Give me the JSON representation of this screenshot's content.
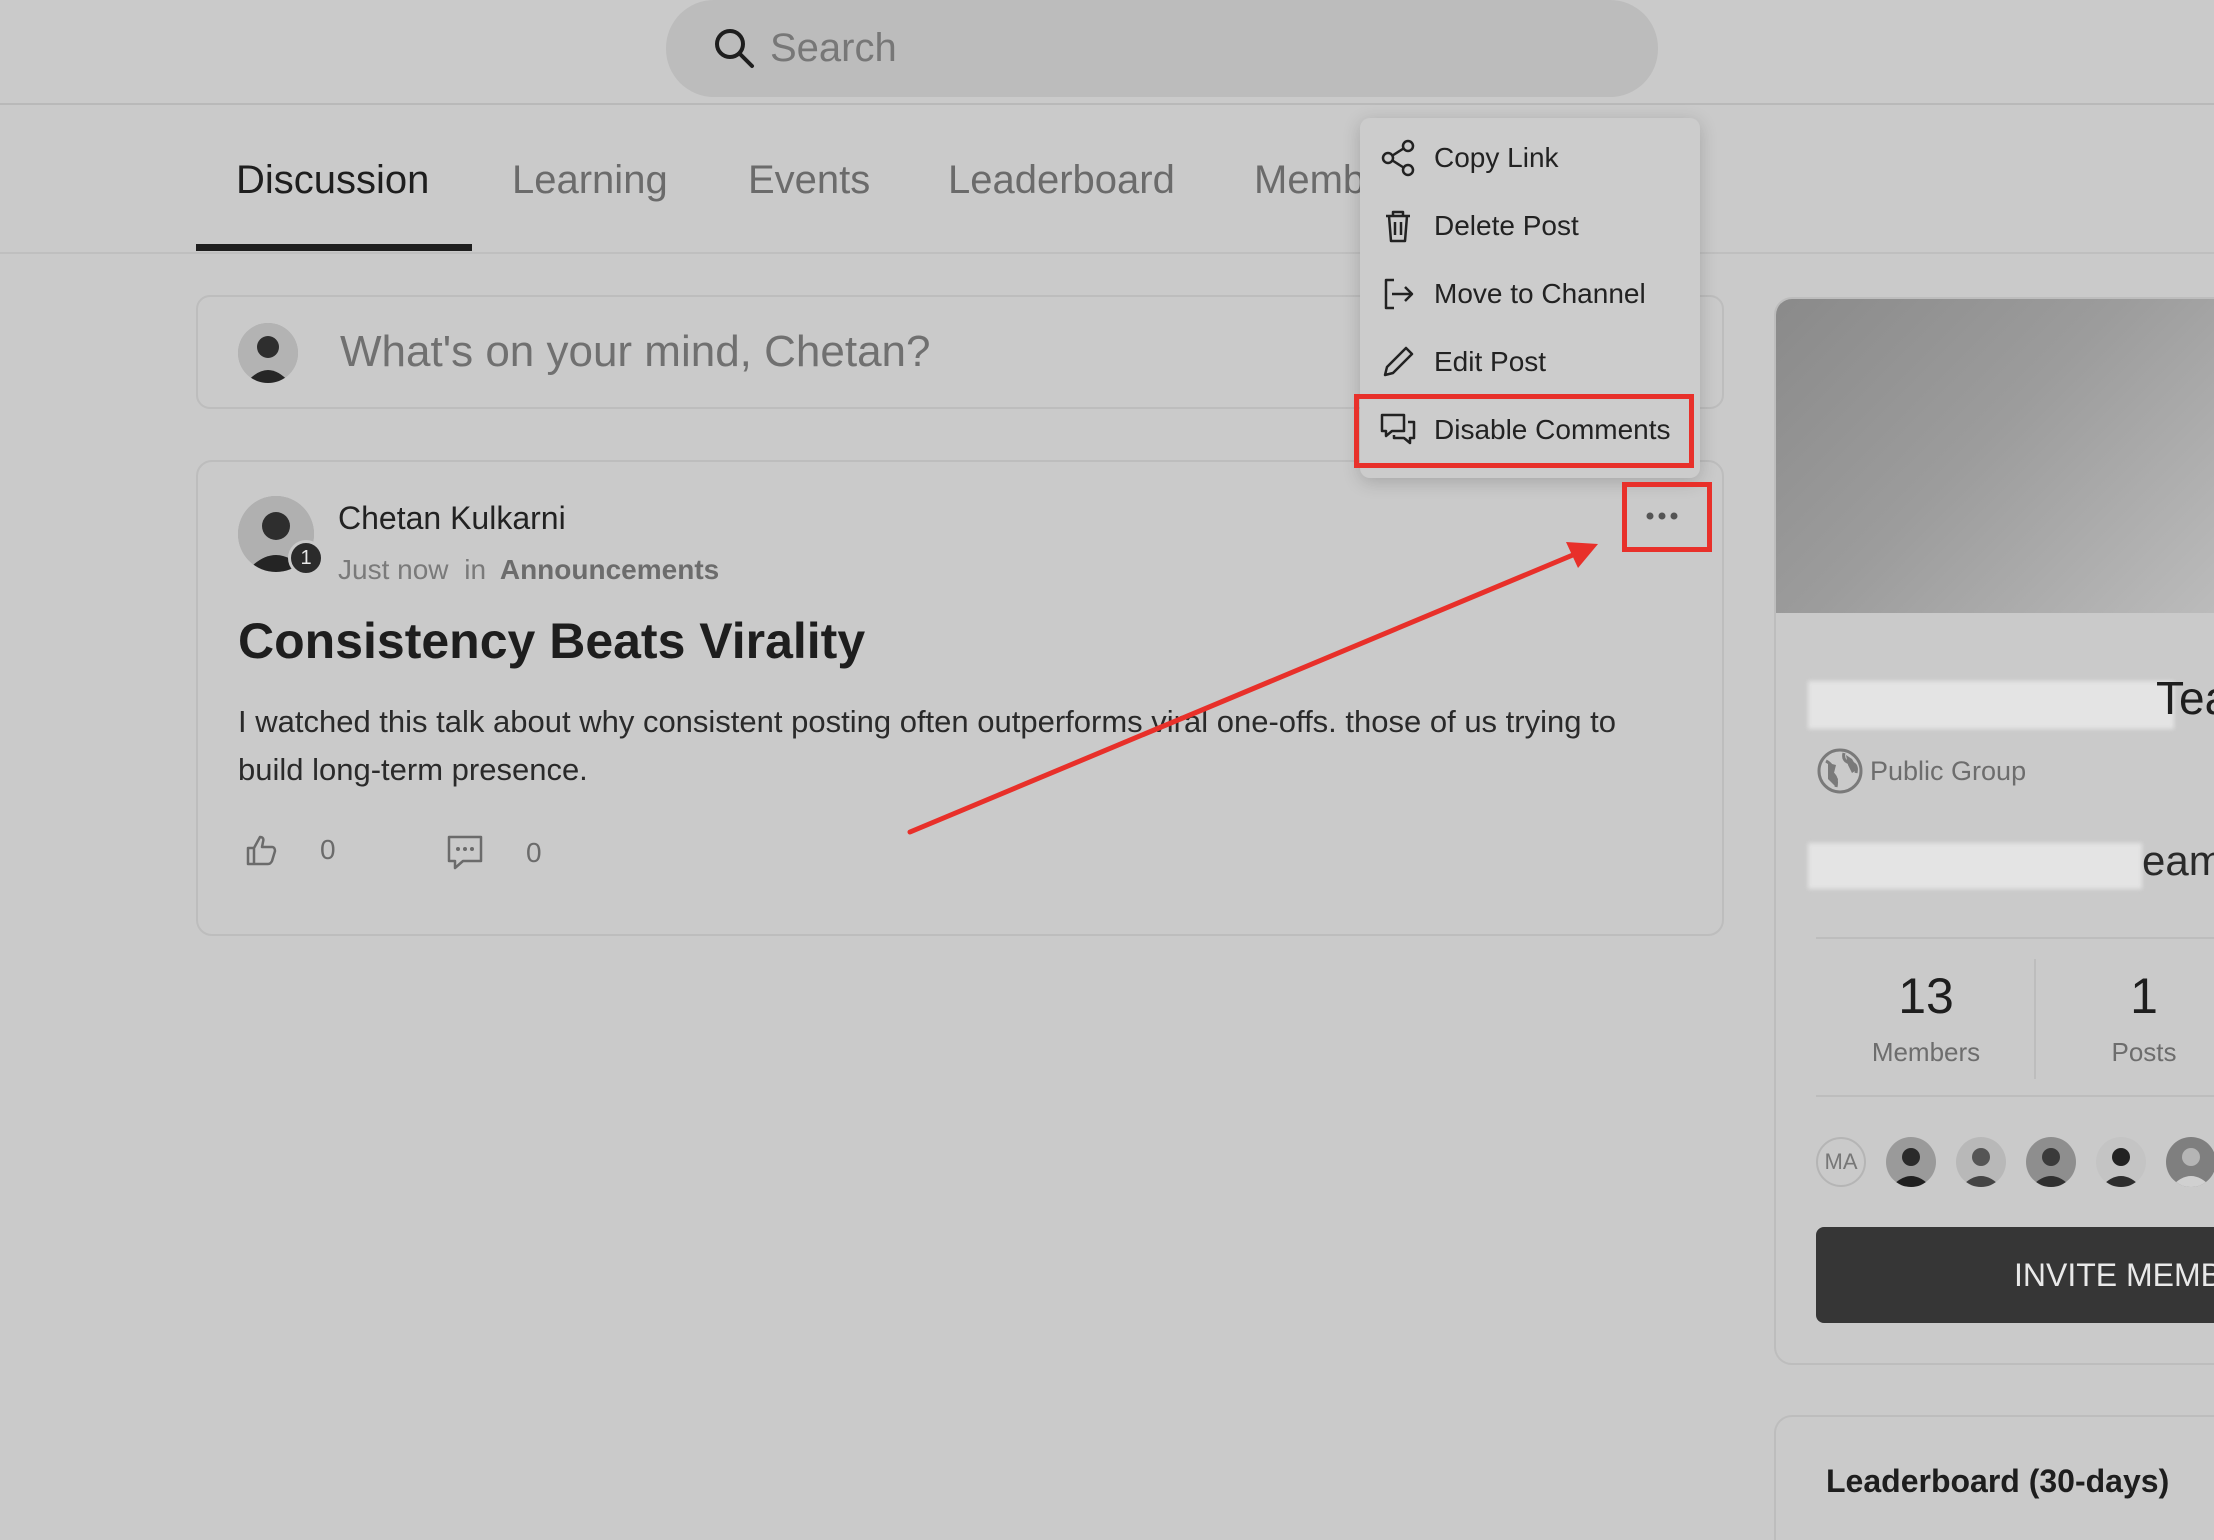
{
  "search": {
    "placeholder": "Search"
  },
  "tabs": [
    {
      "label": "Discussion"
    },
    {
      "label": "Learning"
    },
    {
      "label": "Events"
    },
    {
      "label": "Leaderboard"
    },
    {
      "label": "Memb"
    }
  ],
  "composer": {
    "prompt": "What's on your mind, Chetan?"
  },
  "post": {
    "author": "Chetan Kulkarni",
    "badge": "1",
    "time": "Just now",
    "in_word": "in",
    "channel": "Announcements",
    "title": "Consistency Beats Virality",
    "body": "I watched this talk about why consistent posting often outperforms viral one-offs. those of us trying to build long-term presence.",
    "likes": "0",
    "comments": "0"
  },
  "menu": {
    "items": [
      {
        "label": "Copy Link",
        "icon": "share-icon"
      },
      {
        "label": "Delete Post",
        "icon": "trash-icon"
      },
      {
        "label": "Move to Channel",
        "icon": "move-icon"
      },
      {
        "label": "Edit Post",
        "icon": "pencil-icon"
      },
      {
        "label": "Disable Comments",
        "icon": "comments-icon"
      }
    ]
  },
  "sidebar": {
    "group_name_tail": "Tea",
    "privacy": "Public Group",
    "subname_tail": "eam",
    "stats": [
      {
        "value": "13",
        "label": "Members"
      },
      {
        "value": "1",
        "label": "Posts"
      }
    ],
    "member_initials": "MA",
    "invite_label": "INVITE MEMB",
    "leaderboard_title": "Leaderboard (30-days)"
  },
  "colors": {
    "background": "#cacaca",
    "highlight": "#e8302a",
    "button_dark": "#363636"
  }
}
